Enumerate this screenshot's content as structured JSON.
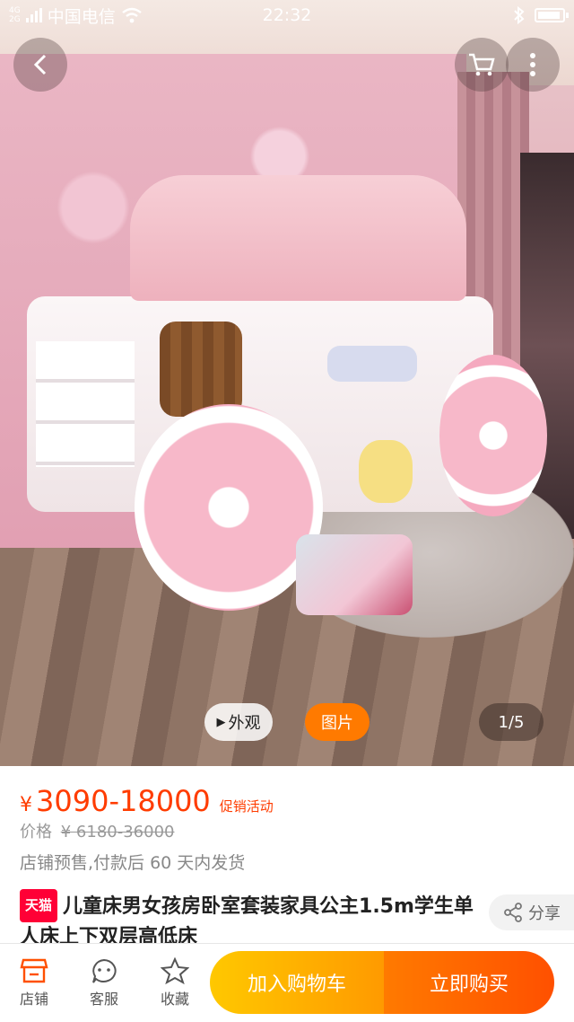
{
  "status_bar": {
    "network_tag_top": "4G",
    "network_tag_bottom": "2G",
    "carrier": "中国电信",
    "time": "22:32"
  },
  "gallery": {
    "exterior_label": "外观",
    "photo_label": "图片",
    "counter": "1/5",
    "accent_color": "#ff7a00"
  },
  "product": {
    "price_symbol": "¥",
    "price_range": "3090-18000",
    "promo_label": "促销活动",
    "original_price_label": "价格",
    "original_price": "¥ 6180-36000",
    "presale_note": "店铺预售,付款后 60 天内发货",
    "tmall_badge": "天猫",
    "title": "儿童床男女孩房卧室套装家具公主1.5m学生单人床上下双层高低床",
    "share_label": "分享"
  },
  "bottom_bar": {
    "shop_label": "店铺",
    "service_label": "客服",
    "favorite_label": "收藏",
    "add_to_cart_label": "加入购物车",
    "buy_now_label": "立即购买"
  }
}
